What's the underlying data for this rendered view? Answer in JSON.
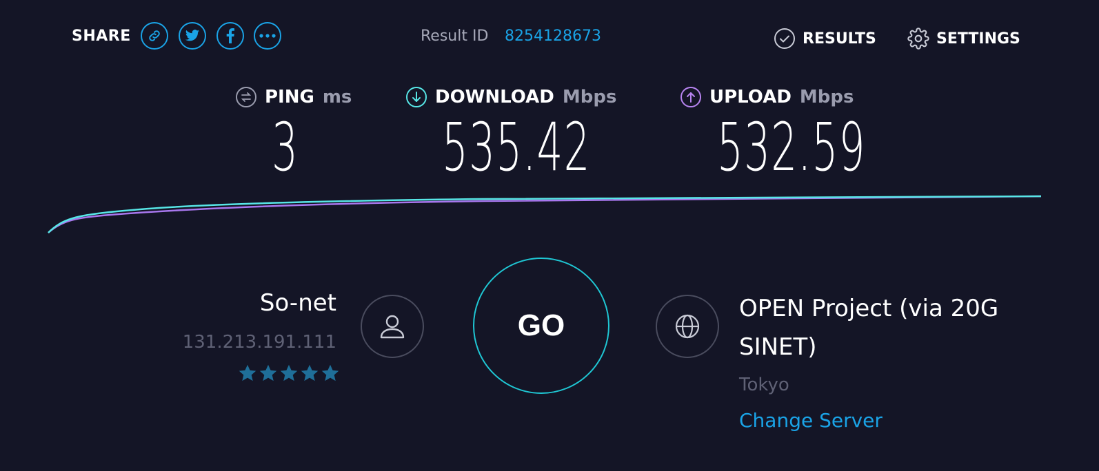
{
  "header": {
    "share_label": "SHARE",
    "share_buttons": [
      "link-icon",
      "twitter-icon",
      "facebook-icon",
      "more-icon"
    ],
    "result_label": "Result ID",
    "result_id": "8254128673",
    "results_label": "RESULTS",
    "settings_label": "SETTINGS"
  },
  "metrics": {
    "ping": {
      "label": "PING",
      "unit": "ms",
      "value": "3",
      "icon": "ping-icon",
      "color": "#9a9cae"
    },
    "download": {
      "label": "DOWNLOAD",
      "unit": "Mbps",
      "value": "535.42",
      "icon": "download-icon",
      "color": "#57e6e6"
    },
    "upload": {
      "label": "UPLOAD",
      "unit": "Mbps",
      "value": "532.59",
      "icon": "upload-icon",
      "color": "#b784f0"
    }
  },
  "colors": {
    "background": "#141526",
    "accent": "#1aa3e6",
    "download_line": "#57e6e6",
    "upload_line": "#a877ee",
    "go_ring": "#1fc7d4",
    "stars": "#1f6f99"
  },
  "isp": {
    "name": "So-net",
    "ip": "131.213.191.111",
    "rating": 5,
    "icon": "user-icon"
  },
  "go_label": "GO",
  "server": {
    "name": "OPEN Project (via 20G SINET)",
    "location": "Tokyo",
    "change_label": "Change Server",
    "icon": "globe-icon"
  }
}
